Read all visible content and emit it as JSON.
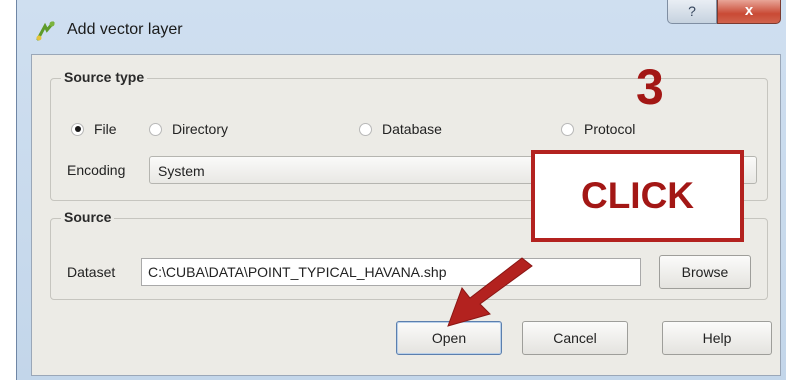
{
  "window": {
    "title": "Add vector layer",
    "help_glyph": "?",
    "close_glyph": "x"
  },
  "source_type": {
    "heading": "Source type",
    "options": [
      "File",
      "Directory",
      "Database",
      "Protocol"
    ],
    "selected": "File",
    "encoding_label": "Encoding",
    "encoding_value": "System"
  },
  "source": {
    "heading": "Source",
    "dataset_label": "Dataset",
    "dataset_value": "C:\\CUBA\\DATA\\POINT_TYPICAL_HAVANA.shp",
    "browse_label": "Browse"
  },
  "buttons": {
    "open": "Open",
    "cancel": "Cancel",
    "help": "Help"
  },
  "annotation": {
    "step": "3",
    "callout": "CLICK",
    "accent": "#b3221f"
  },
  "icons": {
    "app": "qgis-vector-icon",
    "arrow": "pointer-arrow-icon"
  }
}
